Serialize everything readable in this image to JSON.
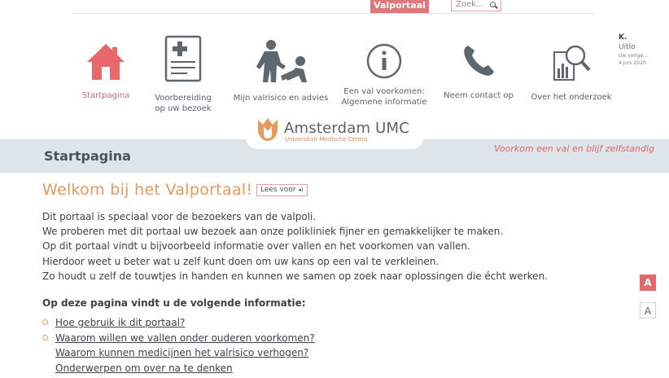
{
  "topbar": {
    "portal_tab": "Valportaal",
    "search_placeholder": "Zoek..."
  },
  "nav": [
    {
      "label": "Startpagina",
      "icon": "home-icon",
      "active": true
    },
    {
      "label": "Voorbereiding op uw bezoek",
      "icon": "clipboard-icon"
    },
    {
      "label": "Mijn valrisico en advies",
      "icon": "fall-risk-icon"
    },
    {
      "label": "Een val voorkomen: Algemene informatie",
      "icon": "info-icon"
    },
    {
      "label": "Neem contact op",
      "icon": "phone-icon"
    },
    {
      "label": "Over het onderzoek",
      "icon": "research-icon"
    }
  ],
  "user": {
    "name": "K.",
    "logout": "Uitlo",
    "last_login_label": "Uw vorige...",
    "last_login_date": "4 juni 2020"
  },
  "logo": {
    "brand": "Amsterdam UMC",
    "subtitle": "Universitair Medische Centra"
  },
  "band": {
    "title": "Startpagina",
    "slogan": "Voorkom een val en blijf zelfstandig"
  },
  "content": {
    "welcome": "Welkom bij het Valportaal!",
    "read_aloud": "Lees voor",
    "intro": [
      "Dit portaal is speciaal voor de bezoekers van de valpoli.",
      "We proberen met dit portaal uw bezoek aan onze polikliniek fijner en gemakkelijker te maken.",
      "Op dit portaal vindt u bijvoorbeeld informatie over vallen en het voorkomen van vallen.",
      "Hierdoor weet u beter wat u zelf kunt doen om uw kans op een val te verkleinen.",
      "Zo houdt u zelf de touwtjes in handen en kunnen we samen op zoek naar oplossingen die écht werken."
    ],
    "subhead": "Op deze pagina vindt u de volgende informatie:",
    "links": [
      "Hoe gebruik ik dit portaal?",
      "Waarom willen we vallen onder ouderen voorkomen?",
      "Waarom kunnen medicijnen het valrisico verhogen?",
      "Onderwerpen om over na te denken"
    ]
  },
  "accessibility": {
    "font_larger": "A",
    "font_smaller": "A"
  },
  "colors": {
    "accent": "#e0777a",
    "orange": "#e8995e",
    "band": "#dee5ea",
    "icon_grey": "#5d676d"
  }
}
